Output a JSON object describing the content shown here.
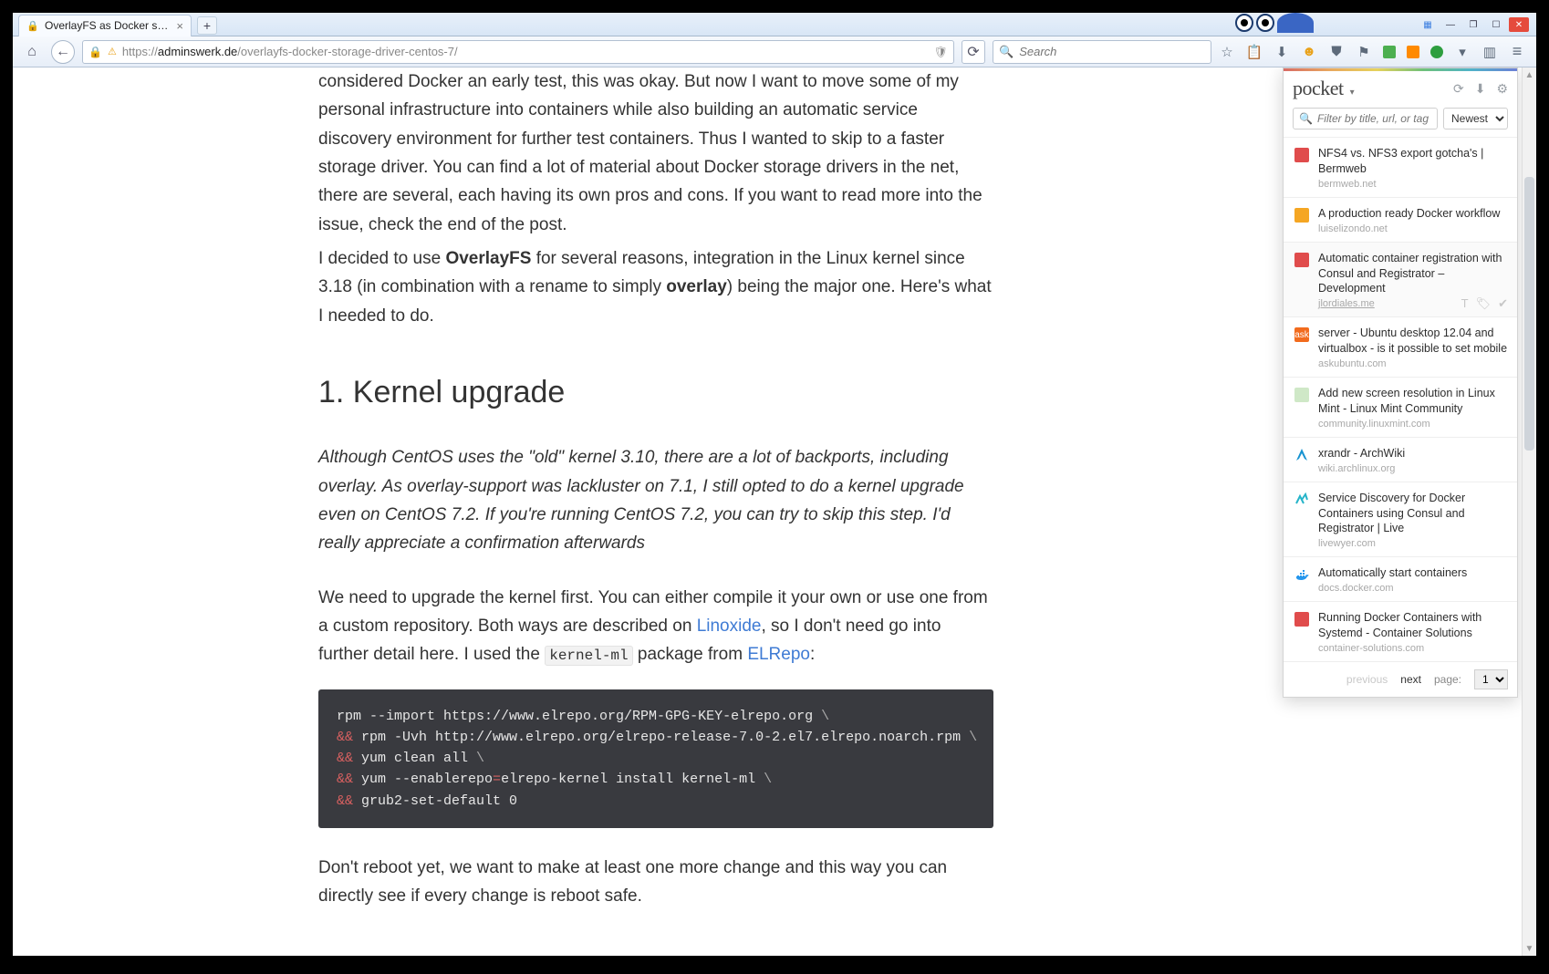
{
  "browser": {
    "tab_title": "OverlayFS as Docker storag…",
    "url_domain": "adminswerk.de",
    "url_path": "/overlayfs-docker-storage-driver-centos-7/",
    "search_placeholder": "Search"
  },
  "article": {
    "p1a": "considered Docker an early test, this was okay. But now I want to move some of my personal infrastructure into containers while also building an automatic service discovery environment for further test containers. Thus I wanted to skip to a faster storage driver. You can find a lot of material about Docker storage drivers in the net, there are several, each having its own pros and cons. If you want to read more into the issue, check the end of the post.",
    "p1b_pre": "I decided to use ",
    "p1b_strong1": "OverlayFS",
    "p1b_mid": " for several reasons, integration in the Linux kernel since 3.18 (in combination with a rename to simply ",
    "p1b_strong2": "overlay",
    "p1b_post": ") being the major one. Here's what I needed to do.",
    "h2": "1. Kernel upgrade",
    "em": "Although CentOS uses the \"old\" kernel 3.10, there are a lot of backports, including overlay. As overlay-support was lackluster on 7.1, I still opted to do a kernel upgrade even on CentOS 7.2. If you're running CentOS 7.2, you can try to skip this step. I'd really appreciate a confirmation afterwards",
    "p3_pre": "We need to upgrade the kernel first. You can either compile it your own or use one from a custom repository. Both ways are described on ",
    "p3_link1": "Linoxide",
    "p3_mid": ", so I don't need go into further detail here. I used the ",
    "p3_code": "kernel-ml",
    "p3_mid2": " package from ",
    "p3_link2": "ELRepo",
    "p3_post": ":",
    "code_l1": "rpm --import https://www.elrepo.org/RPM-GPG-KEY-elrepo.org ",
    "code_l2": " rpm -Uvh http://www.elrepo.org/elrepo-release-7.0-2.el7.elrepo.noarch.rpm ",
    "code_l3": " yum clean all ",
    "code_l4a": " yum --enablerepo",
    "code_l4b": "elrepo-kernel install kernel-ml ",
    "code_l5": " grub2-set-default 0",
    "amp": "&&",
    "eq": "=",
    "cont": "\\",
    "p4": "Don't reboot yet, we want to make at least one more change and this way you can directly see if every change is reboot safe."
  },
  "pocket": {
    "logo": "pocket",
    "filter_placeholder": "Filter by title, url, or tag",
    "sort_selected": "Newest",
    "items": [
      {
        "title": "NFS4 vs. NFS3 export gotcha's | Bermweb",
        "src": "bermweb.net",
        "iconClass": "ico-red"
      },
      {
        "title": "A production ready Docker workflow",
        "src": "luiselizondo.net",
        "iconClass": "ico-orange"
      },
      {
        "title": "Automatic container registration with Consul and Registrator – Development",
        "src": "jlordiales.me",
        "iconClass": "ico-red",
        "hover": true
      },
      {
        "title": "server - Ubuntu desktop 12.04 and virtualbox - is it possible to set mobile",
        "src": "askubuntu.com",
        "iconClass": "ico-ask"
      },
      {
        "title": "Add new screen resolution in Linux Mint - Linux Mint Community",
        "src": "community.linuxmint.com",
        "iconClass": "ico-mint"
      },
      {
        "title": "xrandr - ArchWiki",
        "src": "wiki.archlinux.org",
        "iconClass": "ico-arch"
      },
      {
        "title": "Service Discovery for Docker Containers using Consul and Registrator | Live",
        "src": "livewyer.com",
        "iconClass": "ico-lw"
      },
      {
        "title": "Automatically start containers",
        "src": "docs.docker.com",
        "iconClass": "ico-docker"
      },
      {
        "title": "Running Docker Containers with Systemd - Container Solutions",
        "src": "container-solutions.com",
        "iconClass": "ico-red"
      }
    ],
    "prev": "previous",
    "next": "next",
    "page_label": "page:",
    "page_value": "1"
  }
}
